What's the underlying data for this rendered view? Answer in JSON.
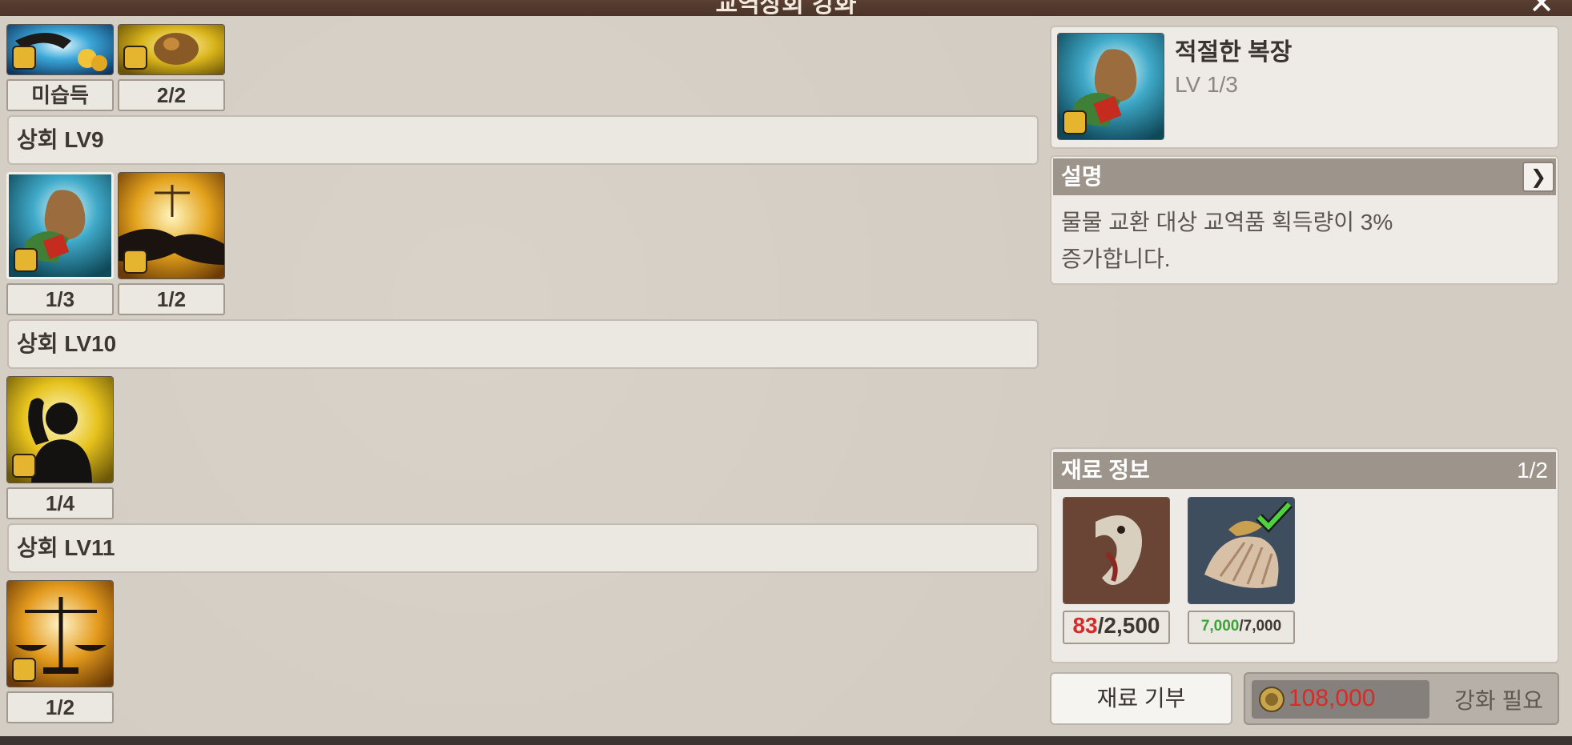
{
  "window": {
    "title": "교역상회 강화",
    "close_glyph": "✕"
  },
  "sections": [
    {
      "label": "상회 LV9"
    },
    {
      "label": "상회 LV10"
    },
    {
      "label": "상회 LV11"
    }
  ],
  "skills": [
    {
      "name": "handshake-coins-skill",
      "level": "미습득"
    },
    {
      "name": "gold-ore-skill",
      "level": "2/2"
    },
    {
      "name": "proper-attire-skill",
      "level": "1/3"
    },
    {
      "name": "trade-handshake-skill",
      "level": "1/2"
    },
    {
      "name": "strength-pose-skill",
      "level": "1/4"
    },
    {
      "name": "scales-skill",
      "level": "1/2"
    }
  ],
  "detail": {
    "name": "적절한 복장",
    "level": "LV 1/3",
    "description_header": "설명",
    "description_lines": [
      "물물 교환 대상 교역품 획득량이 3%",
      "증가합니다."
    ],
    "expand_glyph": "❯"
  },
  "materials": {
    "header": "재료 정보",
    "progress": "1/2",
    "items": [
      {
        "name": "snake-head-material",
        "owned": "83",
        "required": "/2,500",
        "owned_color": "#d62b2b",
        "sufficient": false
      },
      {
        "name": "seashell-material",
        "owned": "7,000",
        "required": "/7,000",
        "owned_color": "#3aa336",
        "sufficient": true
      }
    ]
  },
  "actions": {
    "donate_label": "재료 기부",
    "cost": "108,000",
    "cost_color": "#d62b2b",
    "upgrade_label": "강화 필요"
  }
}
